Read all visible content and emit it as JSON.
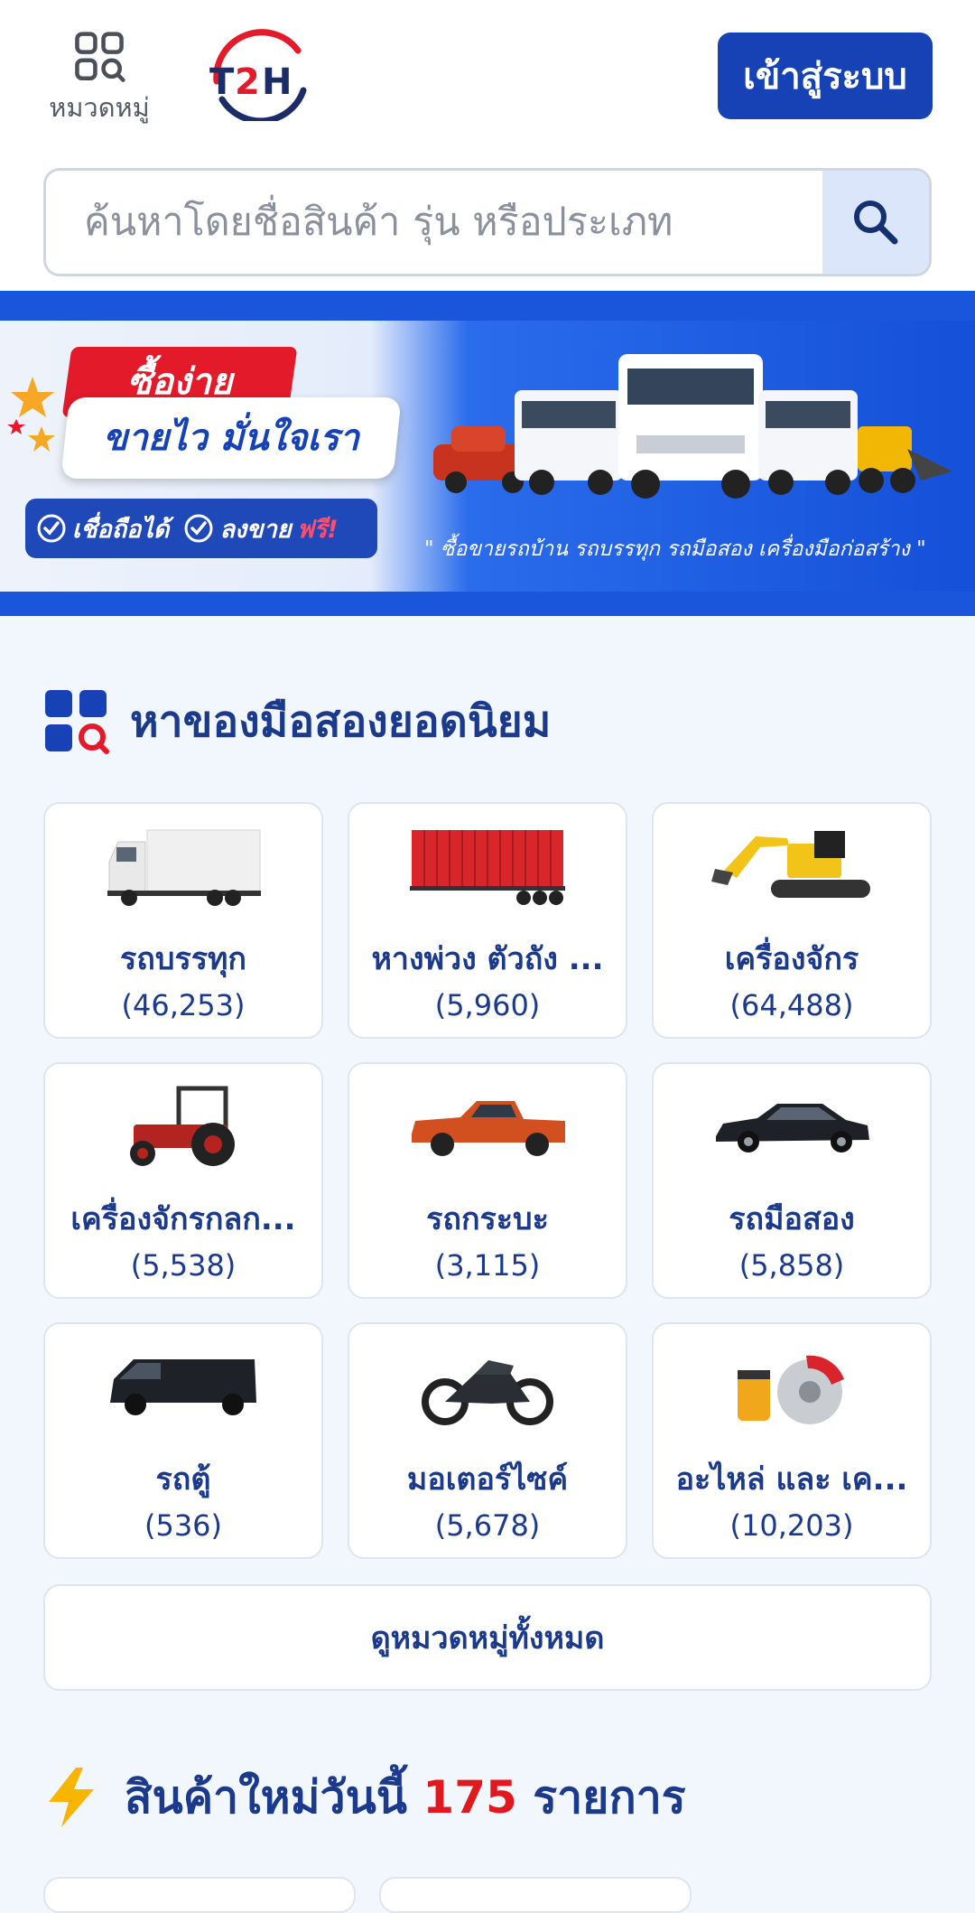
{
  "header": {
    "category_label": "หมวดหมู่",
    "logo_text": "T2H",
    "login_label": "เข้าสู่ระบบ",
    "search_placeholder": "ค้นหาโดยชื่อสินค้า รุ่น หรือประเภท"
  },
  "banner": {
    "headline_1": "ซื้อง่าย",
    "headline_2": "ขายไว มั่นใจเรา",
    "badge_1": "เชื่อถือได้",
    "badge_2_prefix": "ลงขาย",
    "badge_2_free": "ฟรี!",
    "tagline": "\" ซื้อขายรถบ้าน รถบรรทุก รถมือสอง เครื่องมือก่อสร้าง \""
  },
  "popular": {
    "title": "หาของมือสองยอดนิยม",
    "items": [
      {
        "name": "รถบรรทุก",
        "count": "(46,253)",
        "icon": "truck-icon"
      },
      {
        "name": "หางพ่วง ตัวถัง ...",
        "count": "(5,960)",
        "icon": "container-trailer-icon"
      },
      {
        "name": "เครื่องจักร",
        "count": "(64,488)",
        "icon": "excavator-icon"
      },
      {
        "name": "เครื่องจักรกลก...",
        "count": "(5,538)",
        "icon": "tractor-icon"
      },
      {
        "name": "รถกระบะ",
        "count": "(3,115)",
        "icon": "pickup-icon"
      },
      {
        "name": "รถมือสอง",
        "count": "(5,858)",
        "icon": "sedan-icon"
      },
      {
        "name": "รถตู้",
        "count": "(536)",
        "icon": "van-icon"
      },
      {
        "name": "มอเตอร์ไซค์",
        "count": "(5,678)",
        "icon": "motorcycle-icon"
      },
      {
        "name": "อะไหล่ และ เค...",
        "count": "(10,203)",
        "icon": "brake-parts-icon"
      }
    ],
    "view_all": "ดูหมวดหมู่ทั้งหมด"
  },
  "new_today": {
    "prefix": "สินค้าใหม่วันนี้",
    "count": "175",
    "suffix": "รายการ"
  },
  "colors": {
    "primary": "#1642b5",
    "title_text": "#1b3a8c",
    "highlight_red": "#e0191f",
    "page_bg": "#f2f6fd"
  }
}
